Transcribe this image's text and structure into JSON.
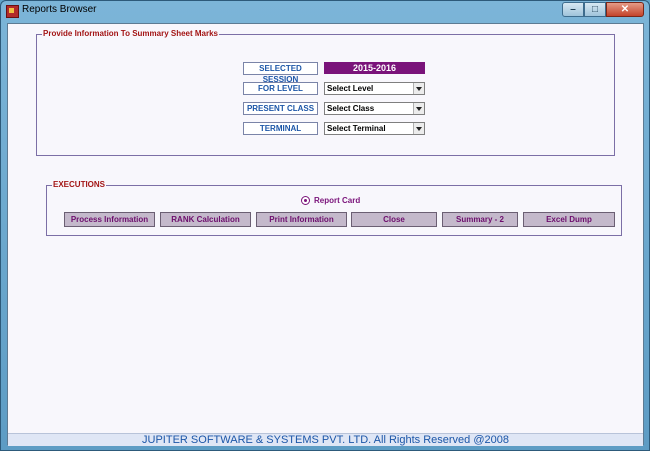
{
  "window": {
    "title": "Reports Browser",
    "controls": {
      "minimize": "–",
      "maximize": "□",
      "close": "✕"
    }
  },
  "info_group": {
    "legend": "Provide Information To Summary Sheet Marks",
    "rows": [
      {
        "label": "SELECTED SESSION",
        "value": "2015-2016"
      },
      {
        "label": "FOR LEVEL",
        "value": "Select Level"
      },
      {
        "label": "PRESENT CLASS",
        "value": "Select Class"
      },
      {
        "label": "TERMINAL",
        "value": "Select Terminal"
      }
    ]
  },
  "executions": {
    "legend": "EXECUTIONS",
    "radio_label": "Report Card",
    "buttons": [
      "Process Information",
      "RANK Calculation",
      "Print Information",
      "Close",
      "Summary - 2",
      "Excel Dump"
    ]
  },
  "footer": "JUPITER SOFTWARE & SYSTEMS PVT. LTD. All Rights Reserved @2008",
  "colors": {
    "accent": "#7a137a",
    "label_text": "#1c56a8",
    "legend_text": "#a31515"
  }
}
